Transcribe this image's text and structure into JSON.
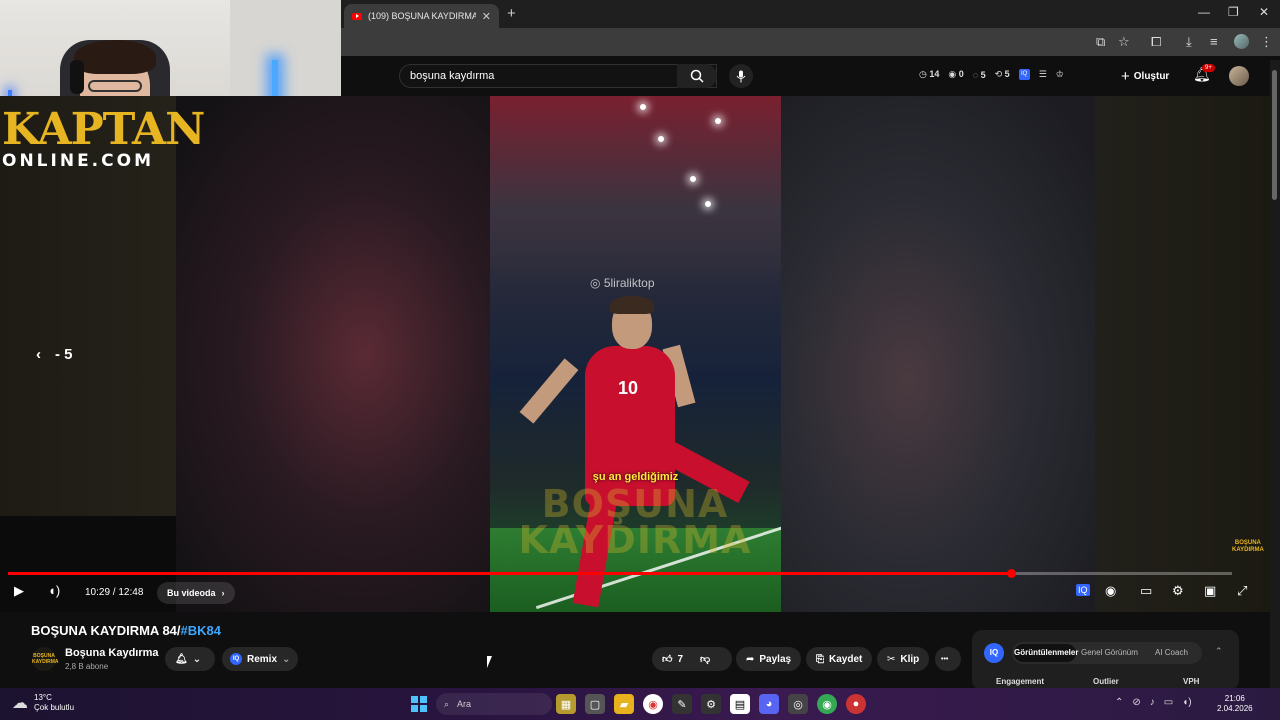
{
  "browser": {
    "tab_title": "(109) BOŞUNA KAYDIRMA 84/#",
    "tab_close": "✕",
    "new_tab": "+",
    "win_minimize": "—",
    "win_maximize": "❐",
    "win_close": "✕"
  },
  "header": {
    "search_value": "boşuna kaydırma",
    "search_clear": "✕",
    "stats": [
      {
        "icon": "clock-icon",
        "value": "14"
      },
      {
        "icon": "eye-icon",
        "value": "0"
      },
      {
        "icon": "comment-icon",
        "value": "5"
      },
      {
        "icon": "share-icon",
        "value": "5"
      }
    ],
    "create_label": "Oluştur",
    "notification_count": "9+"
  },
  "video": {
    "brand_line1": "KAPTAN",
    "brand_line2": "ONLINE.COM",
    "seek_back_label": "- 5",
    "clip_watermark": "5liraliktop",
    "clip_subtitle": "şu an geldiğimiz",
    "clip_logo_line1": "BOŞUNA",
    "clip_logo_line2": "KAYDIRMA",
    "corner_logo_line1": "BOŞUNA",
    "corner_logo_line2": "KAYDIRMA",
    "time_display": "10:29 / 12:48",
    "progress_fraction": 0.8193,
    "chapter_label": "Bu videoda",
    "chapter_chevron": "›"
  },
  "below": {
    "title_main": "BOŞUNA KAYDIRMA 84/",
    "title_tag": "#BK84",
    "channel_logo_line1": "BOŞUNA",
    "channel_logo_line2": "KAYDIRMA",
    "channel_name": "Boşuna Kaydırma",
    "channel_subs": "2,8 B abone",
    "remix_label": "Remix",
    "like_count": "7",
    "share_label": "Paylaş",
    "save_label": "Kaydet",
    "clip_label": "Klip",
    "more_label": "•••"
  },
  "panel": {
    "iq_label": "IQ",
    "tab_active": "Görüntülenmeler",
    "tab_2": "Genel Görünüm",
    "tab_3": "AI Coach",
    "col_1": "Engagement",
    "col_2": "Outlier",
    "col_3": "VPH"
  },
  "taskbar": {
    "temperature": "13°C",
    "weather_text": "Çok bulutlu",
    "search_label": "Ara",
    "time": "21:06",
    "date": "2.04.2026"
  },
  "colors": {
    "accent_red": "#ff0000",
    "link_blue": "#3ea6ff",
    "brand_gold": "#e7b521"
  }
}
